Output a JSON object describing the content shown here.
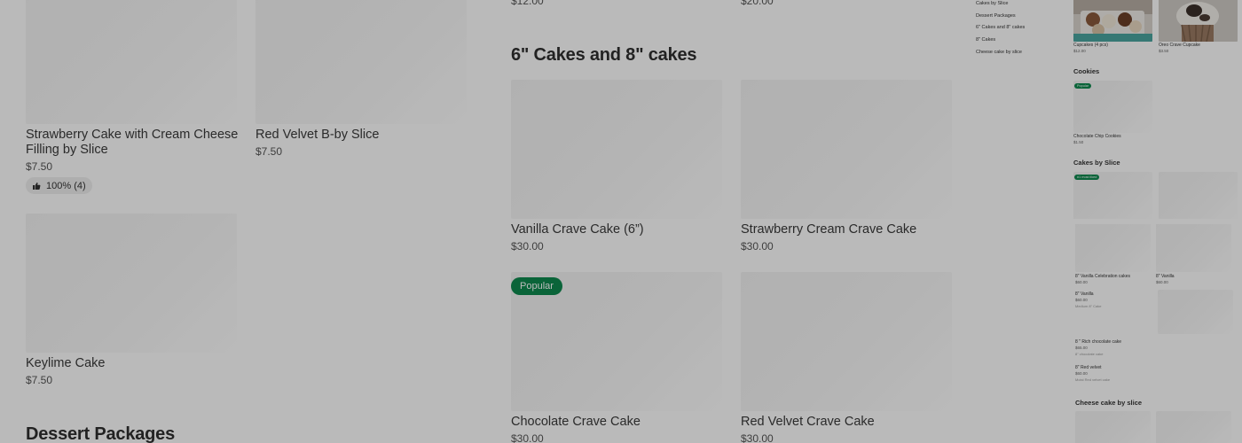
{
  "panel1": {
    "items": [
      {
        "name": "Strawberry Cake with Cream Cheese Filling by Slice",
        "price": "$7.50",
        "rating": "100% (4)"
      },
      {
        "name": "Red Velvet B-by Slice",
        "price": "$7.50"
      },
      {
        "name": "Keylime Cake",
        "price": "$7.50"
      }
    ],
    "section_heading": "Dessert Packages"
  },
  "panel2": {
    "top_prices": [
      "$12.00",
      "$20.00"
    ],
    "section_heading": "6\" Cakes and 8\" cakes",
    "items": [
      {
        "name": "Vanilla Crave Cake (6”)",
        "price": "$30.00"
      },
      {
        "name": "Strawberry Cream Crave Cake",
        "price": "$30.00"
      },
      {
        "name": "Chocolate Crave Cake",
        "price": "$30.00",
        "badge": "Popular"
      },
      {
        "name": "Red Velvet Crave Cake",
        "price": "$30.00"
      }
    ]
  },
  "panel3": {
    "nav": [
      "Cakes by Slice",
      "Dessert Packages",
      "6\" Cakes and 8\" cakes",
      "8\" Cakes",
      "Cheese cake by slice"
    ],
    "items": [
      {
        "name": "Cupcakes (4 pcs)",
        "price": "$12.00"
      },
      {
        "name": "Oreo Crave Cupcake",
        "price": "$3.50"
      }
    ],
    "cookies_heading": "Cookies",
    "cookies_badge": "Popular",
    "cookie_item": {
      "name": "Chocolate Chip Cookies",
      "price": "$1.50"
    },
    "slice_heading": "Cakes by Slice",
    "slice_badge": "#1 most liked"
  },
  "panel4": {
    "items": [
      {
        "name": "8\" Vanilla Celebration cakes",
        "price": "$60.00"
      },
      {
        "name": "8\" Vanilla",
        "price": "$60.00"
      },
      {
        "name": "8\" Vanilla",
        "price": "$60.00",
        "desc": "Medium 8\" Cake"
      },
      {
        "name": "8 \" Rich chocolate cake",
        "price": "$65.00",
        "desc": "8\" chocolate cake"
      },
      {
        "name": "8\" Red velvet",
        "price": "$60.00",
        "desc": "Moist Red velvet cake"
      }
    ],
    "cheese_heading": "Cheese cake by slice"
  },
  "colors": {
    "accent": "#0e8a4f",
    "overlay": "rgba(0,0,0,0.27)"
  }
}
